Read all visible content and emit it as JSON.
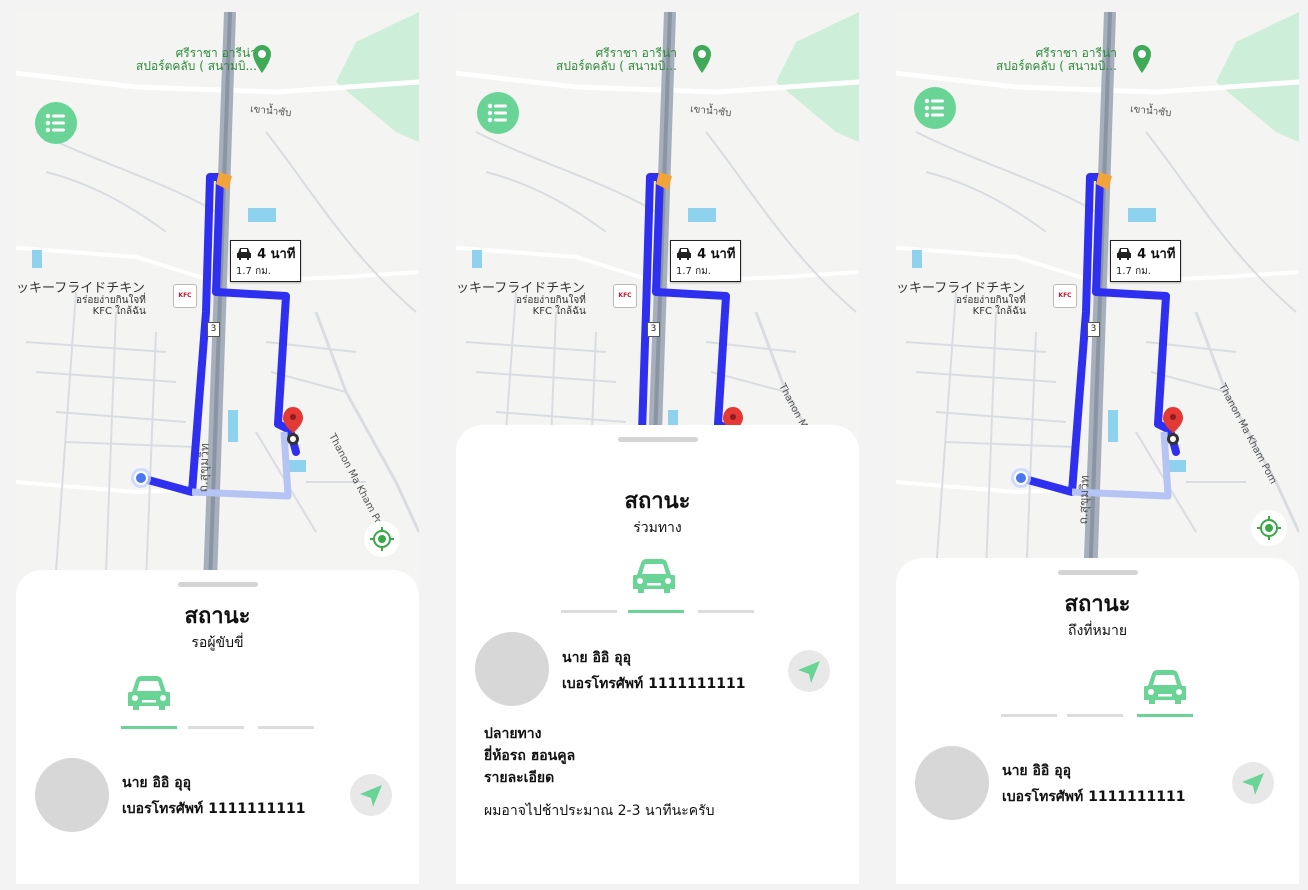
{
  "map": {
    "poi_name_line1": "ศรีราชา อารีน่า",
    "poi_name_line2": "สปอร์ตคลับ (  สนามบิ...",
    "road_khao_nam_sap": "เขาน้ำซับ",
    "restaurant_jp": "ッキーフライドチキン",
    "restaurant_th_line1": "อร่อยง่ายกินใจที่",
    "restaurant_th_line2": "KFC ใกล้ฉัน",
    "kfc_logo_text": "KFC",
    "road_thanon": "Thanon Ma Kham Pom",
    "road_sukhumvit": "ถ.สุขุมวิท",
    "route_shield": "3",
    "eta_time": "4 นาที",
    "eta_distance": "1.7 กม.",
    "route_color": "#2f2ff0",
    "accent_green": "#6ad496",
    "icons": [
      "list-icon",
      "my-location-icon",
      "destination-pin-icon",
      "car-icon",
      "send-icon"
    ]
  },
  "screens": [
    {
      "status_title": "สถานะ",
      "status_text": "รอผู้ขับขี่",
      "active_step": 1,
      "driver_name": "นาย อิอิ อุอุ",
      "driver_phone": "เบอรโทรศัพท์ 1111111111"
    },
    {
      "status_title": "สถานะ",
      "status_text": "ร่วมทาง",
      "active_step": 2,
      "driver_name": "นาย อิอิ อุอุ",
      "driver_phone": "เบอรโทรศัพท์ 1111111111",
      "destination_label": "ปลายทาง",
      "car_brand": "ยี่ห้อรถ ฮอนคูล",
      "details_label": "รายละเอียด",
      "message": "ผมอาจไปช้าประมาณ 2-3 นาทีนะครับ"
    },
    {
      "status_title": "สถานะ",
      "status_text": "ถึงที่หมาย",
      "active_step": 3,
      "driver_name": "นาย อิอิ อุอุ",
      "driver_phone": "เบอรโทรศัพท์ 1111111111"
    }
  ]
}
